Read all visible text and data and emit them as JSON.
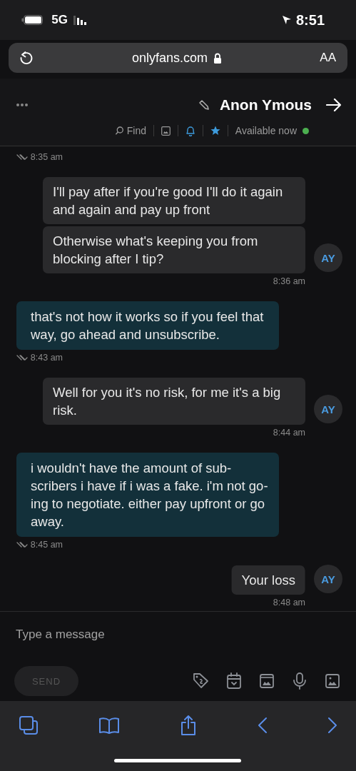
{
  "status_bar": {
    "time": "8:51",
    "network": "5G"
  },
  "browser": {
    "text_size": "AA",
    "url": "onlyfans.com"
  },
  "chat_header": {
    "title": "Anon Ymous",
    "online": true,
    "status": "Available now",
    "find": "Find"
  },
  "messages": [
    {
      "kind": "sent",
      "time": "8:35 am"
    },
    {
      "kind": "received",
      "avatar": "AY",
      "bubbles": [
        "I'll pay after if you're good I'll do it again and again and pay up front",
        "Otherwise what's keeping you from blocking after I tip?"
      ],
      "time": "8:36 am"
    },
    {
      "kind": "sent",
      "bubbles": [
        "that's not how it works so if you feel that way, go ahead and unsubscribe."
      ],
      "time": "8:43 am"
    },
    {
      "kind": "received",
      "avatar": "AY",
      "bubbles": [
        "Well for you it's no risk, for me it's a big risk."
      ],
      "time": "8:44 am"
    },
    {
      "kind": "sent",
      "bubbles": [
        "i wouldn't have the amount of sub-scribers i have if i was a fake. i'm not go-ing to negotiate. either pay upfront or go away."
      ],
      "time": "8:45 am"
    },
    {
      "kind": "received",
      "avatar": "AY",
      "bubbles": [
        "Your loss"
      ],
      "time": "8:48 am"
    }
  ],
  "composer": {
    "placeholder": "Type a message",
    "send": {
      "label": "SEND",
      "disabled": true
    }
  }
}
